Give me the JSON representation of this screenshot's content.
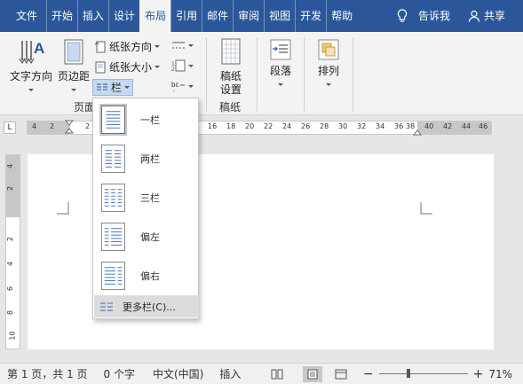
{
  "tabs": [
    {
      "label": "文件"
    },
    {
      "label": "开始"
    },
    {
      "label": "插入"
    },
    {
      "label": "设计"
    },
    {
      "label": "布局"
    },
    {
      "label": "引用"
    },
    {
      "label": "邮件"
    },
    {
      "label": "审阅"
    },
    {
      "label": "视图"
    },
    {
      "label": "开发"
    },
    {
      "label": "帮助"
    }
  ],
  "tell_me": "告诉我",
  "share": "共享",
  "ribbon": {
    "text_direction": "文字方向",
    "margins": "页边距",
    "orientation": "纸张方向",
    "size": "纸张大小",
    "columns": "栏",
    "page_setup_group": "页面",
    "manuscript_settings": "稿纸设置",
    "manuscript_group": "稿纸",
    "paragraph": "段落",
    "arrange": "排列"
  },
  "columns_menu": {
    "items": [
      {
        "label": "一栏"
      },
      {
        "label": "两栏"
      },
      {
        "label": "三栏"
      },
      {
        "label": "偏左"
      },
      {
        "label": "偏右"
      }
    ],
    "more": "更多栏(C)..."
  },
  "ruler": {
    "corner": "L",
    "h_ticks": [
      "4",
      "2",
      "",
      "2",
      "",
      "16",
      "18",
      "20",
      "22",
      "24",
      "26",
      "28",
      "30",
      "32",
      "34",
      "36",
      "38",
      "40",
      "42",
      "44",
      "46"
    ],
    "v_ticks": [
      "4",
      "2",
      "",
      "2",
      "4",
      "6",
      "8",
      "10"
    ]
  },
  "status": {
    "page": "第 1 页，共 1 页",
    "words": "0 个字",
    "language": "中文(中国)",
    "mode": "插入",
    "zoom": "71%",
    "zoom_level": 0.71
  },
  "colors": {
    "brand": "#2b579a",
    "ribbon_bg": "#f3f3f3",
    "selected_button": "#c5d9f1"
  }
}
